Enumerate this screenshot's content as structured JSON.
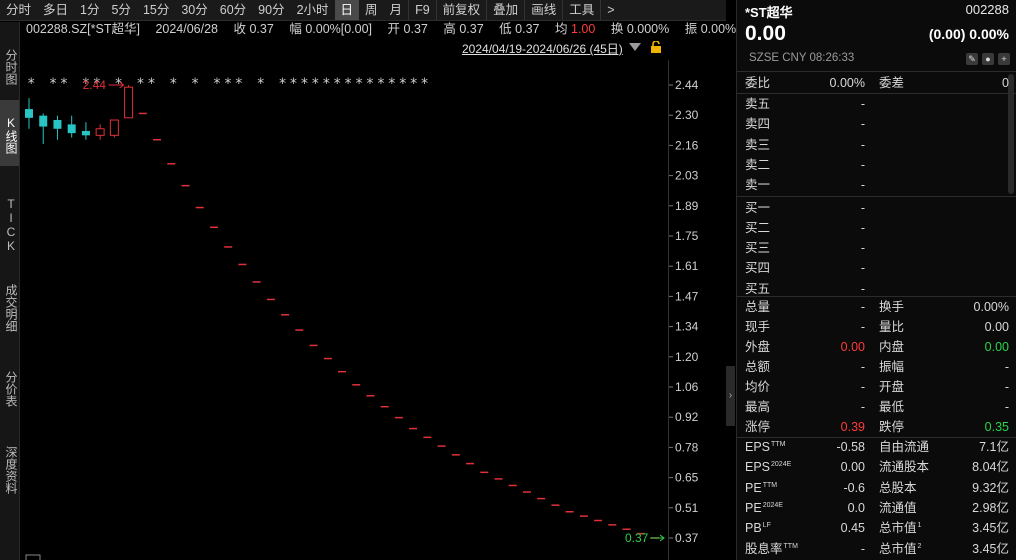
{
  "toolbar": {
    "periods": [
      "分时",
      "多日",
      "1分",
      "5分",
      "15分",
      "30分",
      "60分",
      "90分",
      "2小时",
      "日",
      "周",
      "月"
    ],
    "active_period": "日",
    "tools": [
      "F9",
      "前复权",
      "叠加",
      "画线",
      "工具"
    ],
    "more": ">"
  },
  "left_tabs": [
    "分时图",
    "K线图",
    "TICK",
    "成交明细",
    "分价表",
    "深度资料"
  ],
  "active_left_tab": "K线图",
  "info": {
    "code_name": "002288.SZ[*ST超华]",
    "date": "2024/06/28",
    "close_label": "收",
    "close": "0.37",
    "amp_label": "幅",
    "amp": "0.00%[0.00]",
    "open_label": "开",
    "open": "0.37",
    "high_label": "高",
    "high": "0.37",
    "low_label": "低",
    "low": "0.37",
    "avg_label": "均",
    "avg": "1.00",
    "turnover_label": "换",
    "turnover": "0.000%",
    "swing_label": "振",
    "swing": "0.00%"
  },
  "date_range": "2024/04/19-2024/06/26 (45日)",
  "chart_data": {
    "type": "candlestick",
    "ylim": [
      0.3,
      2.5
    ],
    "y_ticks": [
      "2.44",
      "2.30",
      "2.16",
      "2.03",
      "1.89",
      "1.75",
      "1.61",
      "1.47",
      "1.34",
      "1.20",
      "1.06",
      "0.92",
      "0.78",
      "0.65",
      "0.51",
      "0.37"
    ],
    "max_label": "2.44",
    "min_label": "0.37",
    "markers": "* ** ** * ** * * *** * **************",
    "colors": {
      "up": "#e0303a",
      "down": "#29c4c4",
      "min": "#2bd24a"
    },
    "candles": [
      {
        "o": 2.33,
        "h": 2.38,
        "l": 2.24,
        "c": 2.29
      },
      {
        "o": 2.3,
        "h": 2.31,
        "l": 2.17,
        "c": 2.25
      },
      {
        "o": 2.28,
        "h": 2.3,
        "l": 2.19,
        "c": 2.24
      },
      {
        "o": 2.26,
        "h": 2.3,
        "l": 2.2,
        "c": 2.22
      },
      {
        "o": 2.23,
        "h": 2.27,
        "l": 2.19,
        "c": 2.21
      },
      {
        "o": 2.21,
        "h": 2.26,
        "l": 2.19,
        "c": 2.24
      },
      {
        "o": 2.21,
        "h": 2.28,
        "l": 2.2,
        "c": 2.28
      },
      {
        "o": 2.29,
        "h": 2.44,
        "l": 2.29,
        "c": 2.43
      },
      {
        "o": 2.31,
        "h": 2.31,
        "l": 2.31,
        "c": 2.31
      },
      {
        "o": 2.19,
        "h": 2.19,
        "l": 2.19,
        "c": 2.19
      },
      {
        "o": 2.08,
        "h": 2.08,
        "l": 2.08,
        "c": 2.08
      },
      {
        "o": 1.98,
        "h": 1.98,
        "l": 1.98,
        "c": 1.98
      },
      {
        "o": 1.88,
        "h": 1.88,
        "l": 1.88,
        "c": 1.88
      },
      {
        "o": 1.79,
        "h": 1.79,
        "l": 1.79,
        "c": 1.79
      },
      {
        "o": 1.7,
        "h": 1.7,
        "l": 1.7,
        "c": 1.7
      },
      {
        "o": 1.62,
        "h": 1.62,
        "l": 1.62,
        "c": 1.62
      },
      {
        "o": 1.54,
        "h": 1.54,
        "l": 1.54,
        "c": 1.54
      },
      {
        "o": 1.46,
        "h": 1.46,
        "l": 1.46,
        "c": 1.46
      },
      {
        "o": 1.39,
        "h": 1.39,
        "l": 1.39,
        "c": 1.39
      },
      {
        "o": 1.32,
        "h": 1.32,
        "l": 1.32,
        "c": 1.32
      },
      {
        "o": 1.25,
        "h": 1.25,
        "l": 1.25,
        "c": 1.25
      },
      {
        "o": 1.19,
        "h": 1.19,
        "l": 1.19,
        "c": 1.19
      },
      {
        "o": 1.13,
        "h": 1.13,
        "l": 1.13,
        "c": 1.13
      },
      {
        "o": 1.07,
        "h": 1.07,
        "l": 1.07,
        "c": 1.07
      },
      {
        "o": 1.02,
        "h": 1.02,
        "l": 1.02,
        "c": 1.02
      },
      {
        "o": 0.97,
        "h": 0.97,
        "l": 0.97,
        "c": 0.97
      },
      {
        "o": 0.92,
        "h": 0.92,
        "l": 0.92,
        "c": 0.92
      },
      {
        "o": 0.87,
        "h": 0.87,
        "l": 0.87,
        "c": 0.87
      },
      {
        "o": 0.83,
        "h": 0.83,
        "l": 0.83,
        "c": 0.83
      },
      {
        "o": 0.79,
        "h": 0.79,
        "l": 0.79,
        "c": 0.79
      },
      {
        "o": 0.75,
        "h": 0.75,
        "l": 0.75,
        "c": 0.75
      },
      {
        "o": 0.71,
        "h": 0.71,
        "l": 0.71,
        "c": 0.71
      },
      {
        "o": 0.67,
        "h": 0.67,
        "l": 0.67,
        "c": 0.67
      },
      {
        "o": 0.64,
        "h": 0.64,
        "l": 0.64,
        "c": 0.64
      },
      {
        "o": 0.61,
        "h": 0.61,
        "l": 0.61,
        "c": 0.61
      },
      {
        "o": 0.58,
        "h": 0.58,
        "l": 0.58,
        "c": 0.58
      },
      {
        "o": 0.55,
        "h": 0.55,
        "l": 0.55,
        "c": 0.55
      },
      {
        "o": 0.52,
        "h": 0.52,
        "l": 0.52,
        "c": 0.52
      },
      {
        "o": 0.49,
        "h": 0.49,
        "l": 0.49,
        "c": 0.49
      },
      {
        "o": 0.47,
        "h": 0.47,
        "l": 0.47,
        "c": 0.47
      },
      {
        "o": 0.45,
        "h": 0.45,
        "l": 0.45,
        "c": 0.45
      },
      {
        "o": 0.43,
        "h": 0.43,
        "l": 0.43,
        "c": 0.43
      },
      {
        "o": 0.41,
        "h": 0.41,
        "l": 0.41,
        "c": 0.41
      },
      {
        "o": 0.39,
        "h": 0.39,
        "l": 0.39,
        "c": 0.39
      },
      {
        "o": 0.37,
        "h": 0.37,
        "l": 0.37,
        "c": 0.37
      }
    ]
  },
  "quote": {
    "name": "*ST超华",
    "code": "002288",
    "price": "0.00",
    "change": "(0.00) 0.00%",
    "meta": "SZSE  CNY  08:26:33",
    "weibi": {
      "l1": "委比",
      "v1": "0.00%",
      "l2": "委差",
      "v2": "0"
    },
    "book": [
      {
        "label": "卖五",
        "value": "-"
      },
      {
        "label": "卖四",
        "value": "-"
      },
      {
        "label": "卖三",
        "value": "-"
      },
      {
        "label": "卖二",
        "value": "-"
      },
      {
        "label": "卖一",
        "value": "-"
      },
      {
        "label": "买一",
        "value": "-"
      },
      {
        "label": "买二",
        "value": "-"
      },
      {
        "label": "买三",
        "value": "-"
      },
      {
        "label": "买四",
        "value": "-"
      },
      {
        "label": "买五",
        "value": "-"
      }
    ],
    "stats": [
      {
        "l1": "总量",
        "v1": "-",
        "l2": "换手",
        "v2": "0.00%"
      },
      {
        "l1": "现手",
        "v1": "-",
        "l2": "量比",
        "v2": "0.00"
      },
      {
        "l1": "外盘",
        "v1": "0.00",
        "l2": "内盘",
        "v2": "0.00"
      },
      {
        "l1": "总额",
        "v1": "-",
        "l2": "振幅",
        "v2": "-"
      },
      {
        "l1": "均价",
        "v1": "-",
        "l2": "开盘",
        "v2": "-"
      },
      {
        "l1": "最高",
        "v1": "-",
        "l2": "最低",
        "v2": "-"
      },
      {
        "l1": "涨停",
        "v1": "0.39",
        "l2": "跌停",
        "v2": "0.35"
      }
    ],
    "fund": [
      {
        "l1": "EPS",
        "s1": "TTM",
        "v1": "-0.58",
        "l2": "自由流通",
        "s2": "",
        "v2": "7.1亿"
      },
      {
        "l1": "EPS",
        "s1": "2024E",
        "v1": "0.00",
        "l2": "流通股本",
        "s2": "",
        "v2": "8.04亿"
      },
      {
        "l1": "PE",
        "s1": "TTM",
        "v1": "-0.6",
        "l2": "总股本",
        "s2": "",
        "v2": "9.32亿"
      },
      {
        "l1": "PE",
        "s1": "2024E",
        "v1": "0.0",
        "l2": "流通值",
        "s2": "",
        "v2": "2.98亿"
      },
      {
        "l1": "PB",
        "s1": "LF",
        "v1": "0.45",
        "l2": "总市值",
        "s2": "1",
        "v2": "3.45亿"
      },
      {
        "l1": "股息率",
        "s1": "TTM",
        "v1": "-",
        "l2": "总市值",
        "s2": "2",
        "v2": "3.45亿"
      }
    ]
  }
}
